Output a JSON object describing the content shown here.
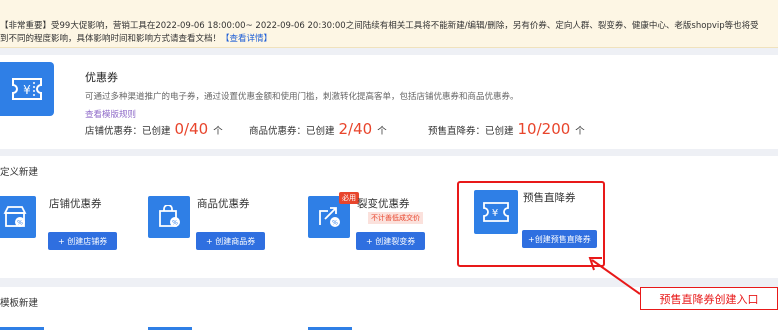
{
  "notice": {
    "line1_text": "【非常重要】受99大促影响，营销工具在2022-09-06 18:00:00~ 2022-09-06 20:30:00之间陆续有相关工具将不能新建/编辑/删除，另有价券、定向人群、裂变券、健康中心、老版shopvip等也将受",
    "line2_text": "到不同的程度影响，具体影响时间和影响方式请查看文档！",
    "line2_link": "【查看详情】"
  },
  "coupon_overview": {
    "icon": "ticket-yen-icon",
    "title": "优惠券",
    "description": "可通过多种渠道推广的电子券，通过设置优惠金额和使用门槛，刺激转化提高客单，包括店铺优惠券和商品优惠券。",
    "rules_link": "查看模版规则",
    "stats": [
      {
        "label": "店铺优惠券：已创建",
        "value": "0/40",
        "unit": "个"
      },
      {
        "label": "商品优惠券：已创建",
        "value": "2/40",
        "unit": "个"
      },
      {
        "label": "预售直降券：已创建",
        "value": "10/200",
        "unit": "个"
      }
    ]
  },
  "custom_create": {
    "section_title": "定义新建",
    "tiles": [
      {
        "name": "店铺优惠券",
        "button": "+ 创建店铺券",
        "icon": "shop-coupon-icon"
      },
      {
        "name": "商品优惠券",
        "button": "+ 创建商品券",
        "icon": "bag-coupon-icon"
      },
      {
        "name": "裂变优惠券",
        "button": "+ 创建裂变券",
        "icon": "share-coupon-icon",
        "badge": "必用",
        "note": "不计善低成交价"
      },
      {
        "name": "预售直降券",
        "button": "+创建预售直降券",
        "icon": "ticket-yen-icon"
      }
    ]
  },
  "template_create": {
    "section_title": "模板新建"
  },
  "annotation": {
    "callout_text": "预售直降券创建入口"
  },
  "colors": {
    "accent_blue": "#2f7fe6",
    "highlight_red": "#e81919",
    "count_red": "#e8452c",
    "notice_bg": "#fdf6e4"
  }
}
